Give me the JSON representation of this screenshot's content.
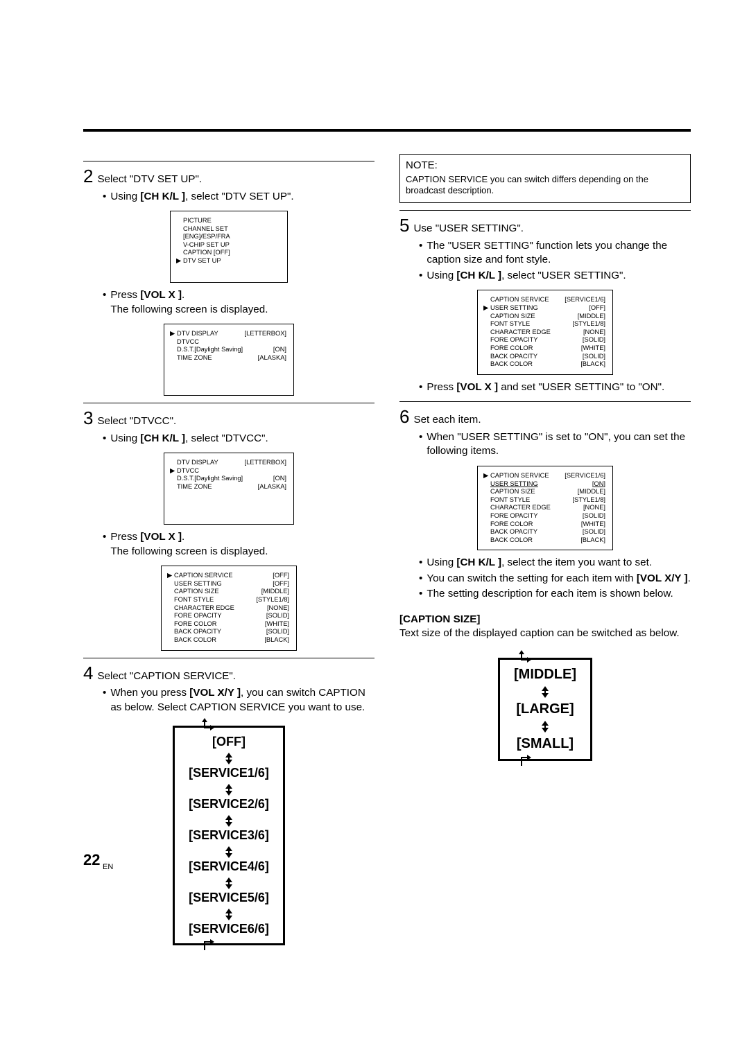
{
  "steps": {
    "s2": {
      "num": "2",
      "title": "Select \"DTV SET UP\".",
      "b1_pre": "Using ",
      "b1_key": "[CH K/L ]",
      "b1_post": ", select \"DTV SET UP\"."
    },
    "s2_osd": {
      "r1": "PICTURE",
      "r2": "CHANNEL SET",
      "r3": "[ENG]/ESP/FRA",
      "r4": "V-CHIP SET UP",
      "r5": "CAPTION [OFF]",
      "r6": "DTV SET UP"
    },
    "s2_press": {
      "pre": "Press ",
      "key": "[VOL X ]",
      "post": ".",
      "line2": "The following screen is displayed."
    },
    "s2_osd2": {
      "r1l": "DTV DISPLAY",
      "r1v": "[LETTERBOX]",
      "r2l": "DTVCC",
      "r3l": "D.S.T.[Daylight Saving]",
      "r3v": "[ON]",
      "r4l": "TIME ZONE",
      "r4v": "[ALASKA]"
    },
    "s3": {
      "num": "3",
      "title": "Select \"DTVCC\".",
      "b1_pre": "Using ",
      "b1_key": "[CH K/L ]",
      "b1_post": ", select \"DTVCC\"."
    },
    "s3_osd": {
      "r1l": "DTV DISPLAY",
      "r1v": "[LETTERBOX]",
      "r2l": "DTVCC",
      "r3l": "D.S.T.[Daylight Saving]",
      "r3v": "[ON]",
      "r4l": "TIME ZONE",
      "r4v": "[ALASKA]"
    },
    "s3_press": {
      "pre": "Press ",
      "key": "[VOL X ]",
      "post": ".",
      "line2": "The following screen is displayed."
    },
    "s3_osd2": {
      "r1l": "CAPTION SERVICE",
      "r1v": "[OFF]",
      "r2l": "USER SETTING",
      "r2v": "[OFF]",
      "r3l": "CAPTION SIZE",
      "r3v": "[MIDDLE]",
      "r4l": "FONT STYLE",
      "r4v": "[STYLE1/8]",
      "r5l": "CHARACTER EDGE",
      "r5v": "[NONE]",
      "r6l": "FORE OPACITY",
      "r6v": "[SOLID]",
      "r7l": "FORE COLOR",
      "r7v": "[WHITE]",
      "r8l": "BACK OPACITY",
      "r8v": "[SOLID]",
      "r9l": "BACK COLOR",
      "r9v": "[BLACK]"
    },
    "s4": {
      "num": "4",
      "title": "Select \"CAPTION SERVICE\".",
      "b1_pre": "When you press ",
      "b1_key": "[VOL X/Y ]",
      "b1_post": ", you can switch CAPTION as below. Select CAPTION SERVICE you want to use."
    },
    "cycle1": {
      "i0": "[OFF]",
      "i1": "[SERVICE1/6]",
      "i2": "[SERVICE2/6]",
      "i3": "[SERVICE3/6]",
      "i4": "[SERVICE4/6]",
      "i5": "[SERVICE5/6]",
      "i6": "[SERVICE6/6]"
    },
    "note": {
      "title": "NOTE:",
      "body": "CAPTION SERVICE you can switch differs depending on the broadcast description."
    },
    "s5": {
      "num": "5",
      "title": "Use \"USER SETTING\".",
      "b1": "The \"USER SETTING\" function lets you change the caption size and font style.",
      "b2_pre": "Using ",
      "b2_key": "[CH K/L ]",
      "b2_post": ", select \"USER SETTING\"."
    },
    "s5_osd": {
      "r1l": "CAPTION SERVICE",
      "r1v": "[SERVICE1/6]",
      "r2l": "USER SETTING",
      "r2v": "[OFF]",
      "r3l": "CAPTION SIZE",
      "r3v": "[MIDDLE]",
      "r4l": "FONT STYLE",
      "r4v": "[STYLE1/8]",
      "r5l": "CHARACTER EDGE",
      "r5v": "[NONE]",
      "r6l": "FORE OPACITY",
      "r6v": "[SOLID]",
      "r7l": "FORE COLOR",
      "r7v": "[WHITE]",
      "r8l": "BACK OPACITY",
      "r8v": "[SOLID]",
      "r9l": "BACK COLOR",
      "r9v": "[BLACK]"
    },
    "s5_press": {
      "pre": "Press ",
      "key": "[VOL X ]",
      "post": " and set \"USER SETTING\" to \"ON\"."
    },
    "s6": {
      "num": "6",
      "title": "Set each item.",
      "b1": "When \"USER SETTING\" is set to \"ON\", you can set the following items."
    },
    "s6_osd": {
      "r1l": "CAPTION SERVICE",
      "r1v": "[SERVICE1/6]",
      "r2l": "USER SETTING",
      "r2v": "[ON]",
      "r3l": "CAPTION SIZE",
      "r3v": "[MIDDLE]",
      "r4l": "FONT STYLE",
      "r4v": "[STYLE1/8]",
      "r5l": "CHARACTER EDGE",
      "r5v": "[NONE]",
      "r6l": "FORE OPACITY",
      "r6v": "[SOLID]",
      "r7l": "FORE COLOR",
      "r7v": "[WHITE]",
      "r8l": "BACK OPACITY",
      "r8v": "[SOLID]",
      "r9l": "BACK COLOR",
      "r9v": "[BLACK]"
    },
    "s6_b2_pre": "Using ",
    "s6_b2_key": "[CH K/L ]",
    "s6_b2_post": ", select the item you want to set.",
    "s6_b3_pre": "You can switch the setting for each item with ",
    "s6_b3_key": "[VOL X/Y ]",
    "s6_b3_post": ".",
    "s6_b4": "The setting description for each item is shown below.",
    "capsize_heading": "[CAPTION SIZE]",
    "capsize_body": "Text size of the displayed caption can be switched as below.",
    "cycle2": {
      "i0": "[MIDDLE]",
      "i1": "[LARGE]",
      "i2": "[SMALL]"
    }
  },
  "page": {
    "num": "22",
    "lang": "EN"
  }
}
